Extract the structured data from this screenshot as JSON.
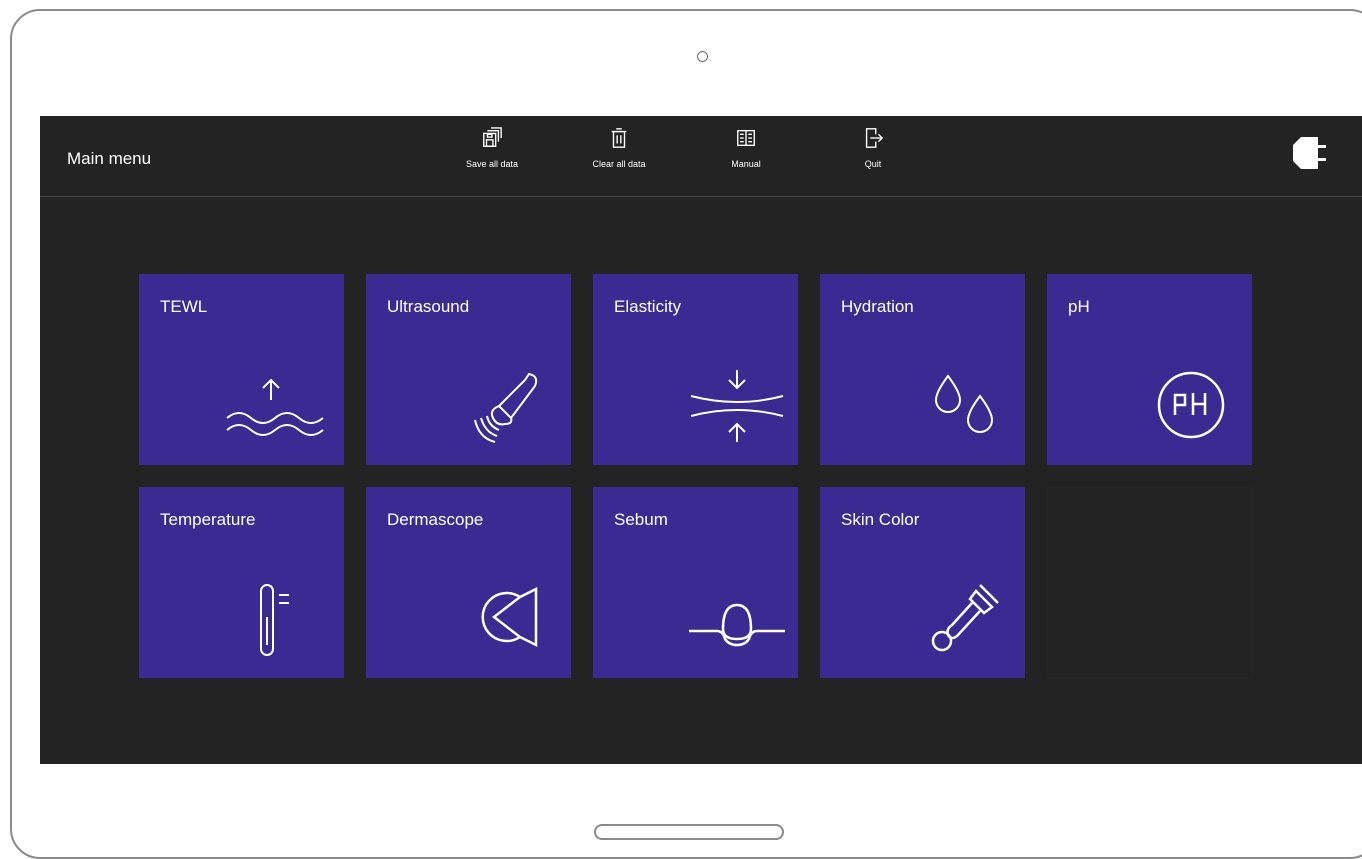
{
  "header": {
    "title": "Main menu"
  },
  "toolbar": {
    "save_label": "Save all data",
    "clear_label": "Clear all data",
    "manual_label": "Manual",
    "quit_label": "Quit"
  },
  "menu": {
    "tiles": [
      {
        "label": "TEWL",
        "icon": "tewl-icon"
      },
      {
        "label": "Ultrasound",
        "icon": "ultrasound-probe-icon"
      },
      {
        "label": "Elasticity",
        "icon": "elasticity-icon"
      },
      {
        "label": "Hydration",
        "icon": "water-drops-icon"
      },
      {
        "label": "pH",
        "icon": "ph-icon"
      },
      {
        "label": "Temperature",
        "icon": "thermometer-icon"
      },
      {
        "label": "Dermascope",
        "icon": "dermascope-icon"
      },
      {
        "label": "Sebum",
        "icon": "sebum-icon"
      },
      {
        "label": "Skin Color",
        "icon": "pipette-icon"
      }
    ]
  },
  "colors": {
    "tile": "#3a2a91",
    "background": "#232323",
    "text": "#ffffff"
  }
}
